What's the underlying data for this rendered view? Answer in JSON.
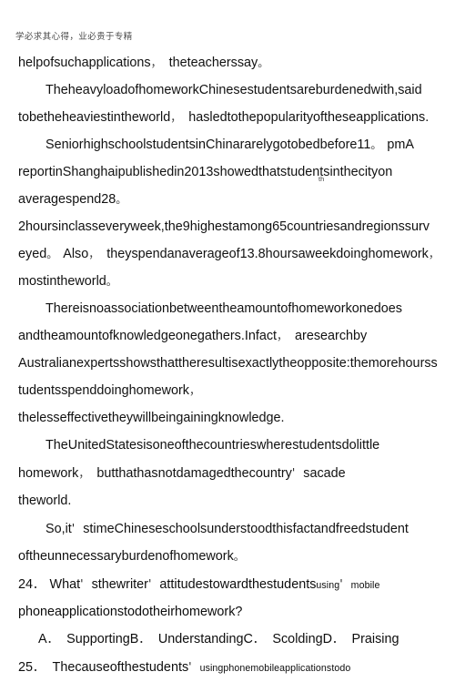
{
  "document": {
    "running_header": "学必求其心得，业必贵于专精",
    "paragraphs": [
      {
        "id": "p1",
        "lines": [
          {
            "text": "helpofsuchapplications",
            "punct_after": "，",
            "text2": "theteacherssay",
            "punct_end": "。",
            "indent": false
          }
        ]
      },
      {
        "id": "p2",
        "lines": [
          {
            "text": "TheheavyloadofhomeworkChinesestudentsareburdenedwith,said",
            "indent": true
          },
          {
            "text": "tobetheheaviestintheworld",
            "punct_after": "，",
            "text2": "hasledtothepopularityoftheseapplications.",
            "indent": false
          }
        ]
      },
      {
        "id": "p3",
        "lines": [
          {
            "text": "SeniorhighschoolstudentsinChinararelygotobedbefore11",
            "punct_after": "。",
            "text2": "pmA",
            "indent": true
          },
          {
            "text": "reportinShanghaipublishedin2013showedthatstudentsinthecityon",
            "indent": false
          },
          {
            "text": "averagespend28",
            "punct_end": "。",
            "superscript": "th",
            "indent": false
          },
          {
            "text": "2hoursinclasseveryweek,the9highestamong65countriesandregionssurv",
            "indent": false
          },
          {
            "text": "eyed",
            "punct_after": "。",
            "text2": "Also",
            "punct_after2": "，",
            "text3": "theyspendanaverageof13.8hoursaweekdoinghomework",
            "punct_end": "，",
            "indent": false
          },
          {
            "text": "mostintheworld",
            "punct_end": "。",
            "indent": false
          }
        ]
      },
      {
        "id": "p4",
        "lines": [
          {
            "text": "Thereisnoassociationbetweentheamountofhomeworkonedoes",
            "indent": true
          },
          {
            "text": "andtheamountofknowledgeonegathers.Infact",
            "punct_after": "，",
            "text2": "aresearchby",
            "indent": false
          },
          {
            "text": "Australianexpertsshowsthattheresultisexactlytheopposite:themorehourss",
            "indent": false
          },
          {
            "text": "tudentsspenddoinghomework",
            "punct_end": "，",
            "indent": false
          },
          {
            "text": "thelesseffectivetheywillbeingainingknowledge.",
            "indent": false
          }
        ]
      },
      {
        "id": "p5",
        "lines": [
          {
            "text": "TheUnitedStatesisoneofthecountrieswherestudentsdolittle",
            "indent": true
          },
          {
            "text": "homework",
            "punct_after": "，",
            "text2": "butthathasnotdamagedthecountry",
            "apostrophe": "'",
            "text3": "sacade",
            "indent": false
          },
          {
            "text": "theworld.",
            "indent": false
          }
        ]
      },
      {
        "id": "p6",
        "lines": [
          {
            "text": "So,it",
            "apostrophe": "'",
            "text2": "stimeChineseschoolsunderstoodthisfactandfreedstudent",
            "indent": true
          },
          {
            "text": "oftheunnecessaryburdenofhomework",
            "punct_end": "。",
            "indent": false
          }
        ]
      }
    ],
    "questions": [
      {
        "number": "24",
        "number_sep": "．",
        "stem_main": "What",
        "apostrophe1": "'",
        "stem_main2": "sthewriter",
        "apostrophe2": "'",
        "stem_main3": "attitudestowardthestudents",
        "stem_small": "using",
        "apostrophe3": "'",
        "stem_small2": "mobile",
        "stem_second_line": "phoneapplicationstodotheirhomework?",
        "options": [
          {
            "label": "A",
            "sep": "．",
            "text": "Supporting"
          },
          {
            "label": "B",
            "sep": "．",
            "text": "Understanding"
          },
          {
            "label": "C",
            "sep": "．",
            "text": "Scolding"
          },
          {
            "label": "D",
            "sep": "．",
            "text": "Praising"
          }
        ]
      },
      {
        "number": "25",
        "number_sep": "．",
        "stem_main": "Thecauseofthestudents",
        "apostrophe1": "'",
        "stem_small": "usingphonemobileapplicationstodo"
      }
    ]
  },
  "colors": {
    "page_background": "#ffffff",
    "body_text": "#111111",
    "header_text": "#4c4c4c"
  }
}
